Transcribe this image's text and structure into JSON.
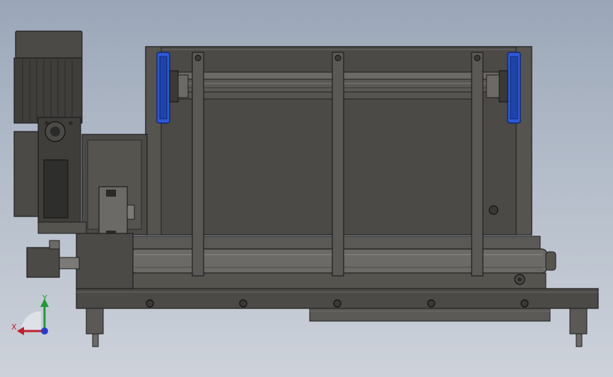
{
  "view": {
    "triad": {
      "x_label": "X",
      "y_label": "Y",
      "x_color": "#c0202a",
      "y_color": "#1f9a3a",
      "z_color": "#2a3bd0"
    }
  },
  "colors": {
    "body_dark": "#4b4a47",
    "body_mid": "#5a5955",
    "body_light": "#6b6a66",
    "edge": "#1e1e1e",
    "accent_blue": "#2c5ad6",
    "shaft": "#7b7a76",
    "cooling_fins": "#3f3e3b"
  }
}
